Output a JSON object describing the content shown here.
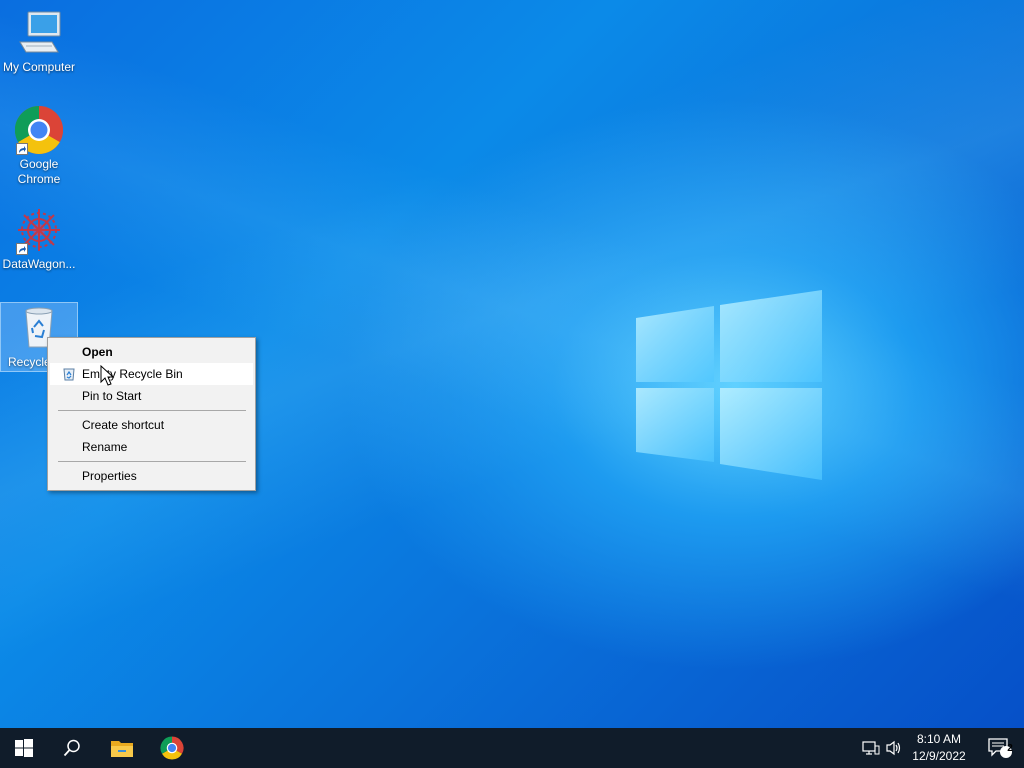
{
  "desktop": {
    "icons": [
      {
        "label": "My Computer",
        "icon": "computer-icon"
      },
      {
        "label": "Google Chrome",
        "icon": "chrome-icon"
      },
      {
        "label": "DataWagon...",
        "icon": "datawagon-icon"
      },
      {
        "label": "Recycle Bin",
        "visible_label": "Recycle",
        "icon": "recycle-bin-icon"
      }
    ]
  },
  "context_menu": {
    "items": [
      {
        "label": "Open",
        "bold": true
      },
      {
        "label": "Empty Recycle Bin",
        "icon": "recycle-bin-small-icon"
      },
      {
        "label": "Pin to Start"
      },
      {
        "label": "Create shortcut"
      },
      {
        "label": "Rename"
      },
      {
        "label": "Properties"
      }
    ]
  },
  "taskbar": {
    "buttons": [
      {
        "name": "start",
        "icon": "windows-logo-icon"
      },
      {
        "name": "search",
        "icon": "search-icon"
      },
      {
        "name": "file-explorer",
        "icon": "folder-icon"
      },
      {
        "name": "chrome",
        "icon": "chrome-icon"
      }
    ],
    "tray": {
      "network_icon": "network-icon",
      "volume_icon": "volume-icon",
      "time": "8:10 AM",
      "date": "12/9/2022",
      "notification_count": "2"
    }
  },
  "colors": {
    "taskbar_bg": "#101c2a",
    "menu_bg": "#f2f2f2",
    "desktop_blue": "#0a74dc"
  }
}
